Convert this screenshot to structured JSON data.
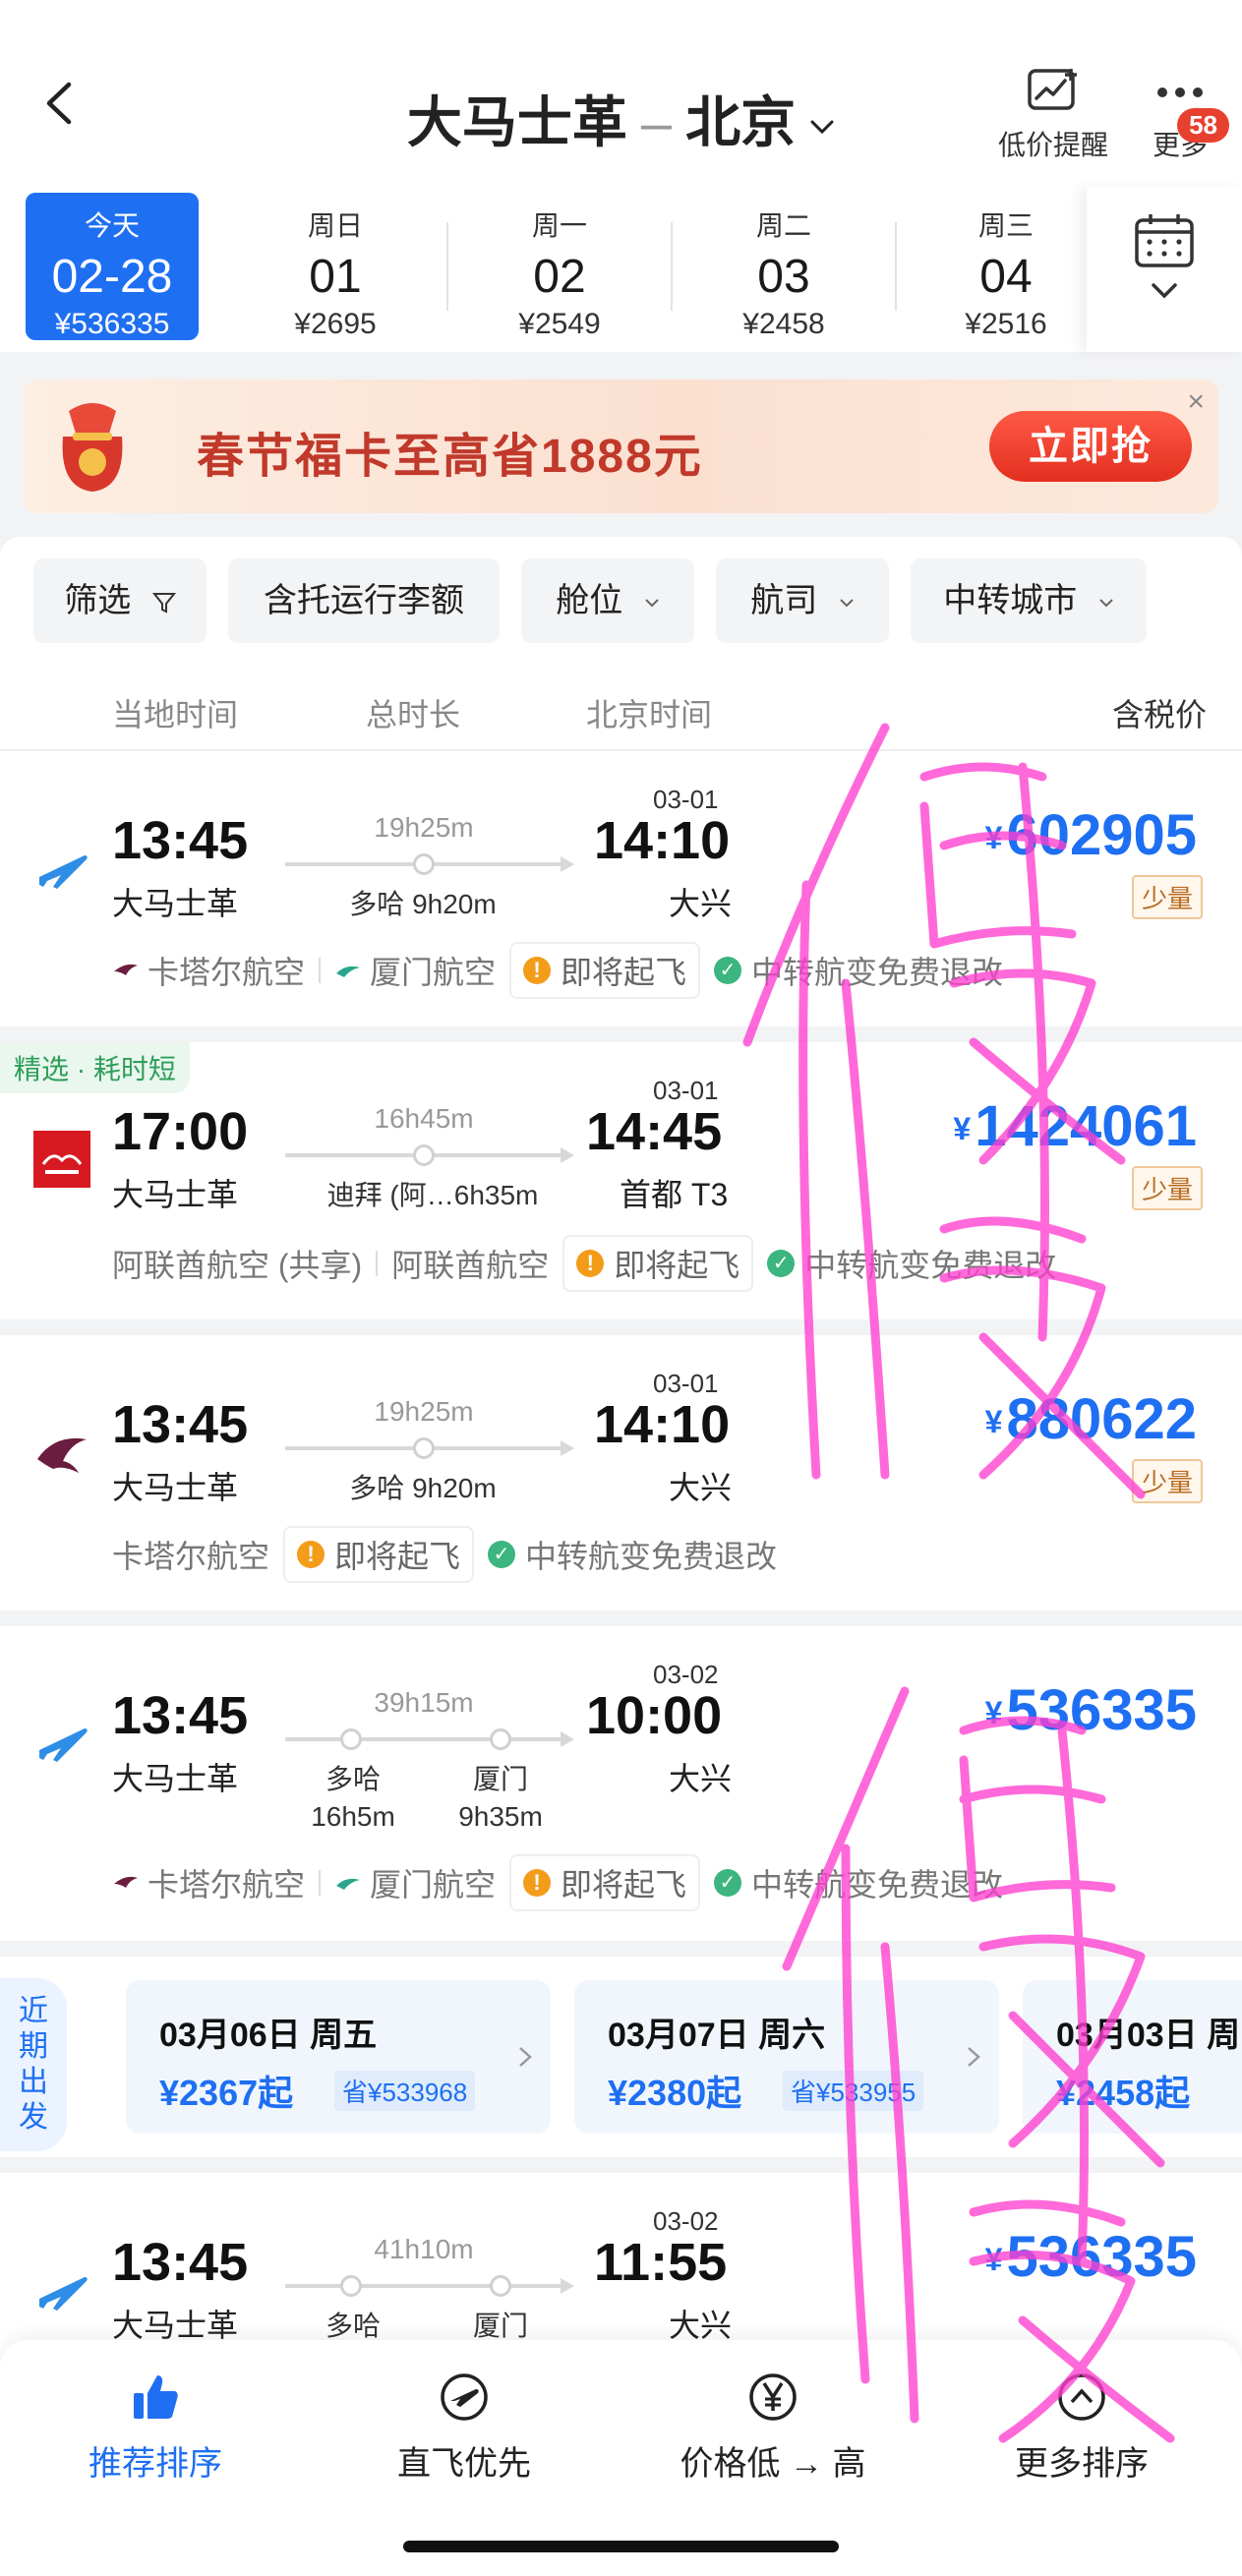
{
  "header": {
    "from": "大马士革",
    "sep": "–",
    "to": "北京",
    "price_alert_label": "低价提醒",
    "more_label": "更多",
    "more_badge": "58"
  },
  "dates": [
    {
      "week": "今天",
      "day": "02-28",
      "price": "¥536335",
      "active": true
    },
    {
      "week": "周日",
      "day": "01",
      "price": "¥2695"
    },
    {
      "week": "周一",
      "day": "02",
      "price": "¥2549"
    },
    {
      "week": "周二",
      "day": "03",
      "price": "¥2458"
    },
    {
      "week": "周三",
      "day": "04",
      "price": "¥2516"
    }
  ],
  "banner": {
    "text": "春节福卡至高省1888元",
    "cta": "立即抢",
    "close": "×"
  },
  "filters": [
    "筛选",
    "含托运行李额",
    "舱位",
    "航司",
    "中转城市"
  ],
  "columns": {
    "local_time": "当地时间",
    "duration": "总时长",
    "beijing_time": "北京时间",
    "price": "含税价"
  },
  "flights": [
    {
      "dep_time": "13:45",
      "dep_airport": "大马士革",
      "duration": "19h25m",
      "via": "多哈 9h20m",
      "arr_date": "03-01",
      "arr_time": "14:10",
      "arr_airport": "大兴",
      "price": "602905",
      "yen": "¥",
      "tag": "少量",
      "airline1": "卡塔尔航空",
      "airline2": "厦门航空",
      "pill": "即将起飞",
      "note": "中转航变免费退改"
    },
    {
      "pick": "精选 · 耗时短",
      "dep_time": "17:00",
      "dep_airport": "大马士革",
      "duration": "16h45m",
      "via": "迪拜 (阿…6h35m",
      "arr_date": "03-01",
      "arr_time": "14:45",
      "arr_airport": "首都 T3",
      "price": "1424061",
      "yen": "¥",
      "tag": "少量",
      "airline1": "阿联酋航空 (共享)",
      "airline2": "阿联酋航空",
      "pill": "即将起飞",
      "note": "中转航变免费退改"
    },
    {
      "dep_time": "13:45",
      "dep_airport": "大马士革",
      "duration": "19h25m",
      "via": "多哈 9h20m",
      "arr_date": "03-01",
      "arr_time": "14:10",
      "arr_airport": "大兴",
      "price": "880622",
      "yen": "¥",
      "tag": "少量",
      "airline1": "卡塔尔航空",
      "pill": "即将起飞",
      "note": "中转航变免费退改"
    },
    {
      "dep_time": "13:45",
      "dep_airport": "大马士革",
      "duration": "39h15m",
      "via1": "多哈",
      "via1_dur": "16h5m",
      "via2": "厦门",
      "via2_dur": "9h35m",
      "arr_date": "03-02",
      "arr_time": "10:00",
      "arr_airport": "大兴",
      "price": "536335",
      "yen": "¥",
      "airline1": "卡塔尔航空",
      "airline2": "厦门航空",
      "pill": "即将起飞",
      "note": "中转航变免费退改"
    },
    {
      "dep_time": "13:45",
      "dep_airport": "大马士革",
      "duration": "41h10m",
      "via1": "多哈",
      "via2": "厦门",
      "arr_date": "03-02",
      "arr_time": "11:55",
      "arr_airport": "大兴",
      "price": "536335",
      "yen": "¥"
    }
  ],
  "nearby": {
    "label": "近期出发",
    "items": [
      {
        "date": "03月06日 周五",
        "price": "¥2367起",
        "save": "省¥533968"
      },
      {
        "date": "03月07日 周六",
        "price": "¥2380起",
        "save": "省¥533955"
      },
      {
        "date": "03月03日 周",
        "price": "¥2458起",
        "save": ""
      }
    ]
  },
  "bottom_bar": [
    "推荐排序",
    "直飞优先",
    "价格低 → 高",
    "更多排序"
  ],
  "overlay_text": "假",
  "colors": {
    "accent": "#1e6ff2",
    "warn": "#f39c1a",
    "ok": "#3cb580",
    "banner_red": "#e32f1f",
    "scribble": "#ff3fd0"
  }
}
